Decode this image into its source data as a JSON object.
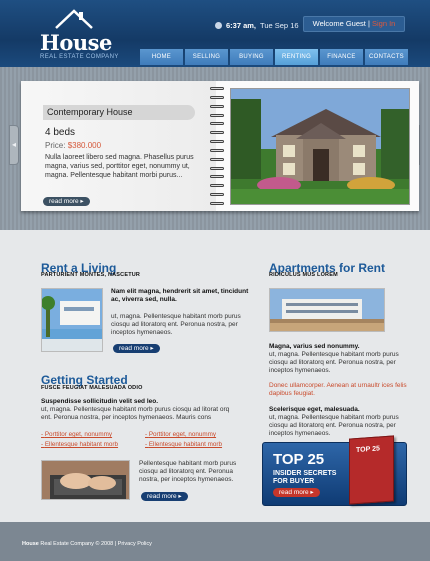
{
  "brand": {
    "name": "House",
    "tagline": "REAL ESTATE COMPANY"
  },
  "header": {
    "time": "6:37 am,",
    "date": "Tue Sep 16",
    "welcome": "Welcome Guest",
    "separator": "|",
    "signin": "Sign In"
  },
  "nav": [
    "HOME",
    "SELLING",
    "BUYING",
    "RENTING",
    "FINANCE",
    "CONTACTS"
  ],
  "featured": {
    "title": "Contemporary House",
    "beds": "4 beds",
    "price_label": "Price:",
    "price": "$380.000",
    "desc": "Nulla laoreet libero sed magna. Phasellus purus magna, varius sed, porttitor eget, nonummy ut, magna. Pellentesque habitant morbi purus...",
    "more": "read more"
  },
  "rent_living": {
    "title": "Rent a Living",
    "subtitle": "PARTURIENT MONTES, NASCETUR",
    "bold": "Nam elit magna, hendrerit sit amet, tincidunt ac, viverra sed, nulla.",
    "text": "ut, magna. Pellentesque habitant morb purus ciosqu ad litoratorq ent. Peronua nostra, per inceptos hymenaeos.",
    "more": "read more"
  },
  "getting_started": {
    "title": "Getting Started",
    "subtitle": "FUSCE FEUGIAT MALESUADA ODIO",
    "bold": "Suspendisse sollicitudin velit sed leo.",
    "text": "ut, magna. Pellentesque habitant morb purus ciosqu ad litorat orq ent. Peronua nostra, per inceptos hymenaeos. Mauris cons",
    "links": [
      "Porttitor eget, nonummy",
      "Porttitor eget, nonummy",
      "Ellentesque habitant morb",
      "Ellentesque habitant morb"
    ],
    "text2": "Pellentesque habitant morb purus ciosqu ad litoratorq ent. Peronua nostra, per inceptos hymenaeos.",
    "more": "read more"
  },
  "apartments": {
    "title": "Apartments for Rent",
    "subtitle": "RIDICULUS MUS LOREM",
    "bold": "Magna, varius sed nonummy.",
    "text": "ut, magna. Pellentesque habitant morb purus ciosqu ad litoratorq ent. Peronua nostra, per inceptos hymenaeos.",
    "red": "Donec ullamcorper. Aenean at urnaultr ices felis dapibus feugiat.",
    "bold2": "Scelerisque eget, malesuada.",
    "text2": "ut, magna. Pellentesque habitant morb purus ciosqu ad litoratorq ent. Peronua nostra, per inceptos hymenaeos."
  },
  "banner": {
    "top": "TOP 25",
    "line1": "INSIDER SECRETS",
    "line2": "FOR BUYER",
    "more": "read more",
    "book_text": "TOP 25"
  },
  "footer": {
    "brand": "House",
    "text": "Real Estate Company © 2008 | Privacy Policy"
  },
  "colors": {
    "accent": "#1d5a99",
    "link": "#c94a2b",
    "header": "#143a66"
  }
}
